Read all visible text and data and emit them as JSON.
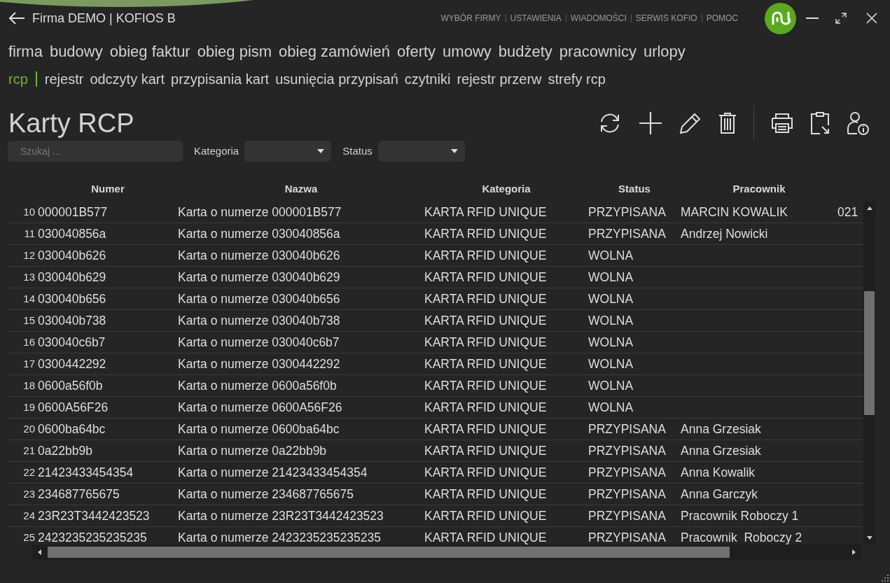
{
  "window": {
    "title": "Firma DEMO | KOFIOS B"
  },
  "top_links": [
    "WYBÓR FIRMY",
    "USTAWIENIA",
    "WIADOMOŚCI",
    "SERWIS KOFIO",
    "POMOC"
  ],
  "nav_primary": [
    "firma",
    "budowy",
    "obieg faktur",
    "obieg pism",
    "obieg zamówień",
    "oferty",
    "umowy",
    "budżety",
    "pracownicy",
    "urlopy"
  ],
  "nav_secondary": {
    "section": "rcp",
    "items": [
      "rejestr",
      "odczyty kart",
      "przypisania kart",
      "usunięcia przypisań",
      "czytniki",
      "rejestr przerw",
      "strefy rcp"
    ]
  },
  "page_title": "Karty RCP",
  "filters": {
    "search": {
      "placeholder": "Szukaj ..."
    },
    "kategoria_label": "Kategoria",
    "status_label": "Status"
  },
  "table": {
    "columns": [
      "Numer",
      "Nazwa",
      "Kategoria",
      "Status",
      "Pracownik"
    ],
    "rows": [
      {
        "index": "10",
        "numer": "000001B577",
        "nazwa": "Karta o numerze 000001B577",
        "kategoria": "KARTA RFID UNIQUE",
        "status": "PRZYPISANA",
        "pracownik": "MARCIN KOWALIK",
        "column_6": "021"
      },
      {
        "index": "11",
        "numer": "030040856a",
        "nazwa": "Karta o numerze 030040856a",
        "kategoria": "KARTA RFID UNIQUE",
        "status": "PRZYPISANA",
        "pracownik": "Andrzej Nowicki"
      },
      {
        "index": "12",
        "numer": "030040b626",
        "nazwa": "Karta o numerze 030040b626",
        "kategoria": "KARTA RFID UNIQUE",
        "status": "WOLNA"
      },
      {
        "index": "13",
        "numer": "030040b629",
        "nazwa": "Karta o numerze 030040b629",
        "kategoria": "KARTA RFID UNIQUE",
        "status": "WOLNA"
      },
      {
        "index": "14",
        "numer": "030040b656",
        "nazwa": "Karta o numerze 030040b656",
        "kategoria": "KARTA RFID UNIQUE",
        "status": "WOLNA"
      },
      {
        "index": "15",
        "numer": "030040b738",
        "nazwa": "Karta o numerze 030040b738",
        "kategoria": "KARTA RFID UNIQUE",
        "status": "WOLNA"
      },
      {
        "index": "16",
        "numer": "030040c6b7",
        "nazwa": "Karta o numerze 030040c6b7",
        "kategoria": "KARTA RFID UNIQUE",
        "status": "WOLNA"
      },
      {
        "index": "17",
        "numer": "0300442292",
        "nazwa": "Karta o numerze 0300442292",
        "kategoria": "KARTA RFID UNIQUE",
        "status": "WOLNA"
      },
      {
        "index": "18",
        "numer": "0600a56f0b",
        "nazwa": "Karta o numerze 0600a56f0b",
        "kategoria": "KARTA RFID UNIQUE",
        "status": "WOLNA"
      },
      {
        "index": "19",
        "numer": "0600A56F26",
        "nazwa": "Karta o numerze 0600A56F26",
        "kategoria": "KARTA RFID UNIQUE",
        "status": "WOLNA"
      },
      {
        "index": "20",
        "numer": "0600ba64bc",
        "nazwa": "Karta o numerze 0600ba64bc",
        "kategoria": "KARTA RFID UNIQUE",
        "status": "PRZYPISANA",
        "pracownik": "Anna Grzesiak"
      },
      {
        "index": "21",
        "numer": "0a22bb9b",
        "nazwa": "Karta o numerze 0a22bb9b",
        "kategoria": "KARTA RFID UNIQUE",
        "status": "PRZYPISANA",
        "pracownik": "Anna Grzesiak"
      },
      {
        "index": "22",
        "numer": "21423433454354",
        "nazwa": "Karta o numerze 21423433454354",
        "kategoria": "KARTA RFID UNIQUE",
        "status": "PRZYPISANA",
        "pracownik": "Anna Kowalik"
      },
      {
        "index": "23",
        "numer": "234687765675",
        "nazwa": "Karta o numerze 234687765675",
        "kategoria": "KARTA RFID UNIQUE",
        "status": "PRZYPISANA",
        "pracownik": "Anna Garczyk"
      },
      {
        "index": "24",
        "numer": "23R23T3442423523",
        "nazwa": "Karta o numerze 23R23T3442423523",
        "kategoria": "KARTA RFID UNIQUE",
        "status": "PRZYPISANA",
        "pracownik": "Pracownik Roboczy 1"
      },
      {
        "index": "25",
        "numer": "2423235235235235",
        "nazwa": "Karta o numerze 2423235235235235",
        "kategoria": "KARTA RFID UNIQUE",
        "status": "PRZYPISANA",
        "pracownik": "Pracownik  Roboczy 2"
      }
    ]
  }
}
